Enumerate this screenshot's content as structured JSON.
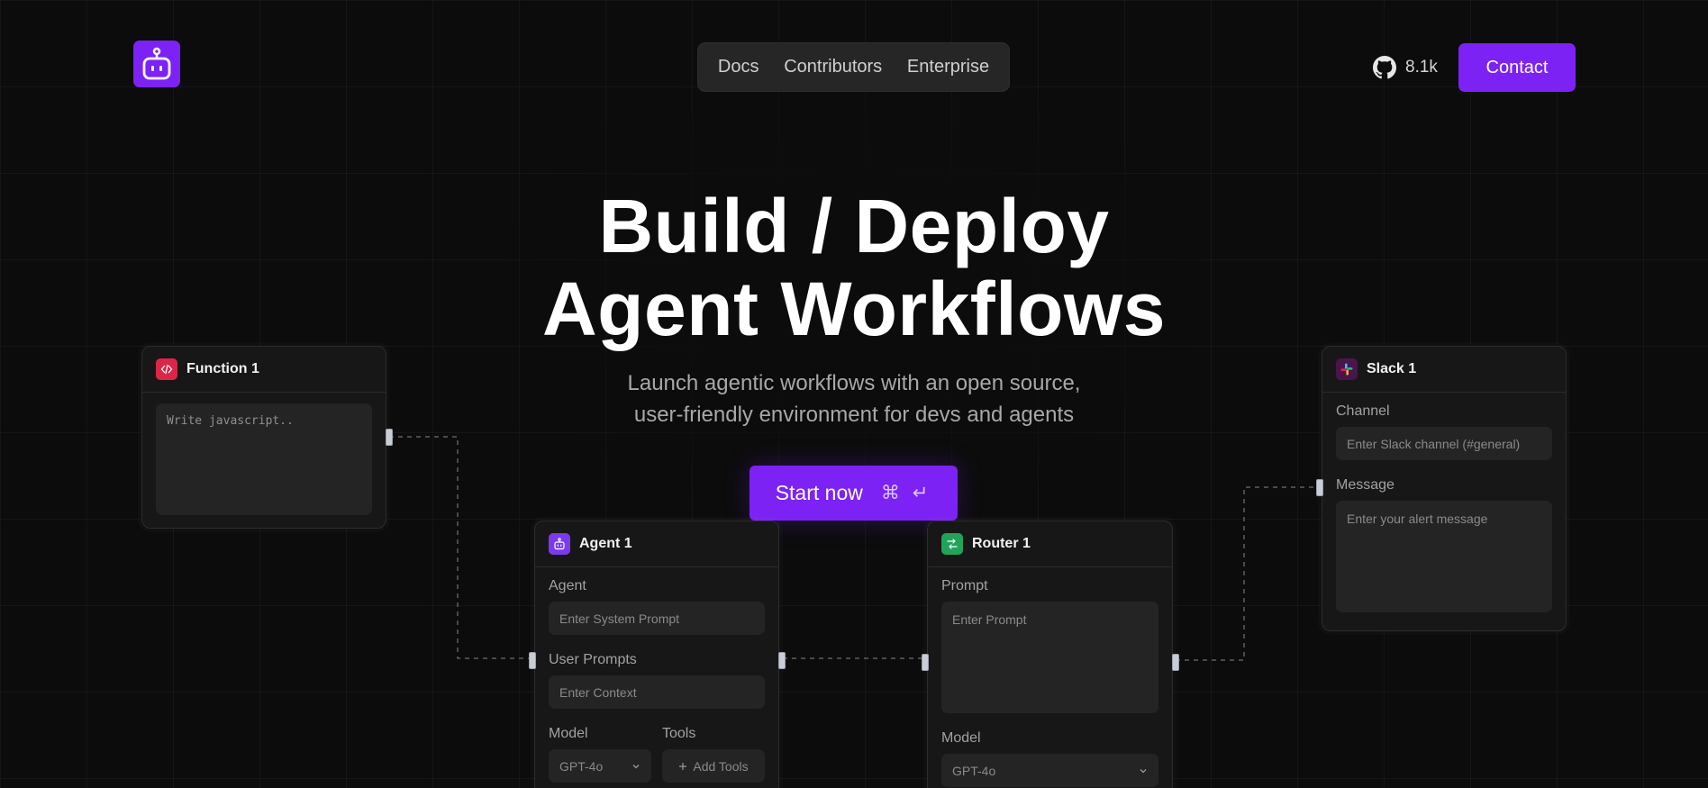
{
  "header": {
    "nav": [
      "Docs",
      "Contributors",
      "Enterprise"
    ],
    "github_stars": "8.1k",
    "contact_label": "Contact"
  },
  "hero": {
    "title_line1": "Build / Deploy",
    "title_line2": "Agent Workflows",
    "subtitle_line1": "Launch agentic workflows with an open source,",
    "subtitle_line2": "user-friendly environment for devs and agents",
    "cta_label": "Start now",
    "cta_shortcut": "⌘ ↵"
  },
  "nodes": {
    "function": {
      "title": "Function 1",
      "code_placeholder": "Write javascript..",
      "icon_color": "#dc2648"
    },
    "agent": {
      "title": "Agent 1",
      "agent_label": "Agent",
      "agent_placeholder": "Enter System Prompt",
      "user_prompts_label": "User Prompts",
      "user_prompts_placeholder": "Enter Context",
      "model_label": "Model",
      "model_value": "GPT-4o",
      "tools_label": "Tools",
      "tools_button": "Add Tools",
      "icon_color": "#7c3aed"
    },
    "router": {
      "title": "Router 1",
      "prompt_label": "Prompt",
      "prompt_placeholder": "Enter Prompt",
      "model_label": "Model",
      "model_value": "GPT-4o",
      "icon_color": "#22a35a"
    },
    "slack": {
      "title": "Slack 1",
      "channel_label": "Channel",
      "channel_placeholder": "Enter Slack channel (#general)",
      "message_label": "Message",
      "message_placeholder": "Enter your alert message",
      "icon_color": "#4a154b"
    }
  },
  "colors": {
    "accent": "#7c22f5",
    "background": "#0c0c0c",
    "card": "#171717"
  }
}
